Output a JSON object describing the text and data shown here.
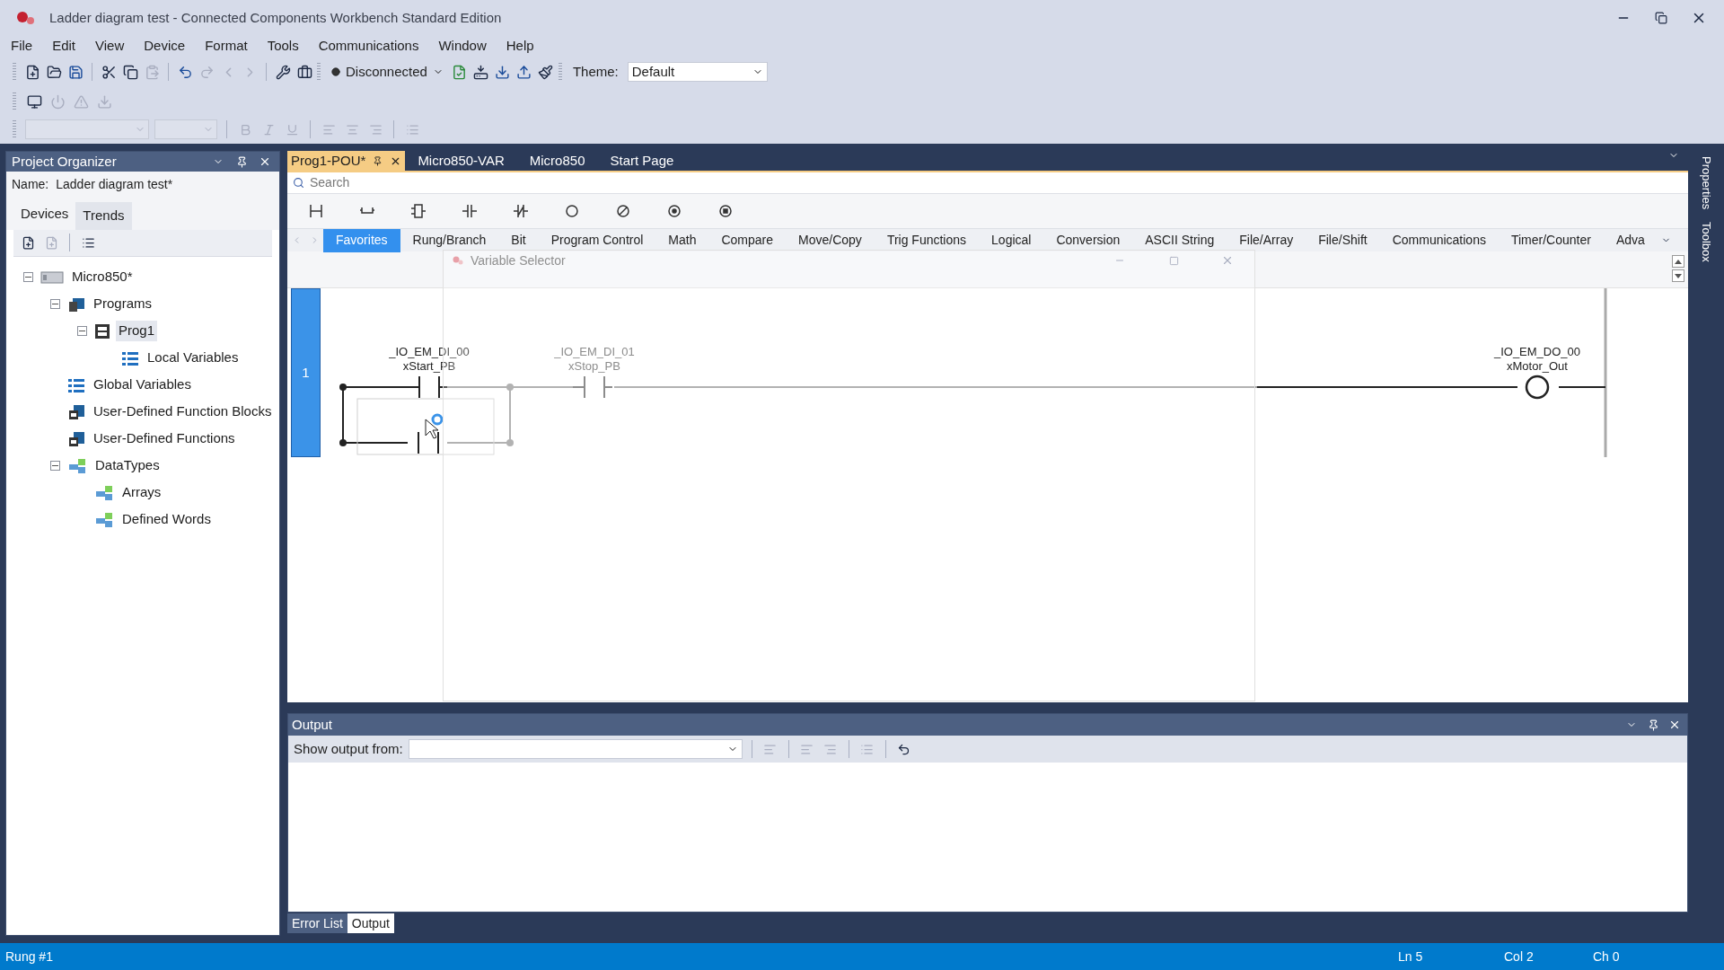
{
  "window": {
    "title": "Ladder diagram test - Connected Components Workbench Standard Edition"
  },
  "menu": [
    "File",
    "Edit",
    "View",
    "Device",
    "Format",
    "Tools",
    "Communications",
    "Window",
    "Help"
  ],
  "toolbar": {
    "connection": "Disconnected",
    "theme_label": "Theme:",
    "theme_value": "Default"
  },
  "project_organizer": {
    "title": "Project Organizer",
    "name_label": "Name:",
    "name_value": "Ladder diagram test*",
    "tabs": [
      {
        "label": "Devices",
        "selected": true
      },
      {
        "label": "Trends",
        "selected": false
      }
    ],
    "tree": [
      {
        "label": "Micro850*",
        "kind": "controller",
        "expanded": true,
        "selected": false,
        "children": [
          {
            "label": "Programs",
            "kind": "programs",
            "expanded": true,
            "selected": false,
            "children": [
              {
                "label": "Prog1",
                "kind": "program",
                "expanded": true,
                "selected": true,
                "children": [
                  {
                    "label": "Local Variables",
                    "kind": "variables",
                    "selected": false
                  }
                ]
              }
            ]
          },
          {
            "label": "Global Variables",
            "kind": "variables",
            "selected": false
          },
          {
            "label": "User-Defined Function Blocks",
            "kind": "function-blocks",
            "selected": false
          },
          {
            "label": "User-Defined Functions",
            "kind": "functions",
            "selected": false
          },
          {
            "label": "DataTypes",
            "kind": "datatypes",
            "expanded": true,
            "selected": false,
            "children": [
              {
                "label": "Arrays",
                "kind": "datatypes",
                "selected": false
              },
              {
                "label": "Defined Words",
                "kind": "datatypes",
                "selected": false
              }
            ]
          }
        ]
      }
    ]
  },
  "editor_tabs": [
    {
      "label": "Prog1-POU*",
      "selected": true
    },
    {
      "label": "Micro850-VAR",
      "selected": false
    },
    {
      "label": "Micro850",
      "selected": false
    },
    {
      "label": "Start Page",
      "selected": false
    }
  ],
  "toolbox": {
    "search_placeholder": "Search",
    "categories": [
      {
        "label": "Favorites",
        "selected": true
      },
      {
        "label": "Rung/Branch",
        "selected": false
      },
      {
        "label": "Bit",
        "selected": false
      },
      {
        "label": "Program Control",
        "selected": false
      },
      {
        "label": "Math",
        "selected": false
      },
      {
        "label": "Compare",
        "selected": false
      },
      {
        "label": "Move/Copy",
        "selected": false
      },
      {
        "label": "Trig Functions",
        "selected": false
      },
      {
        "label": "Logical",
        "selected": false
      },
      {
        "label": "Conversion",
        "selected": false
      },
      {
        "label": "ASCII String",
        "selected": false
      },
      {
        "label": "File/Array",
        "selected": false
      },
      {
        "label": "File/Shift",
        "selected": false
      },
      {
        "label": "Communications",
        "selected": false
      },
      {
        "label": "Timer/Counter",
        "selected": false
      },
      {
        "label": "Adva",
        "selected": false
      }
    ]
  },
  "variable_selector": {
    "title": "Variable Selector"
  },
  "rung": {
    "number": "1",
    "elements": [
      {
        "kind": "contact",
        "address": "_IO_EM_DI_00",
        "variable": "xStart_PB",
        "dimmed": false
      },
      {
        "kind": "contact",
        "address": "_IO_EM_DI_01",
        "variable": "xStop_PB",
        "dimmed": true
      },
      {
        "kind": "coil",
        "address": "_IO_EM_DO_00",
        "variable": "xMotor_Out",
        "dimmed": false
      }
    ]
  },
  "output": {
    "title": "Output",
    "show_label": "Show output from:"
  },
  "bottom_tabs": [
    {
      "label": "Error List",
      "selected": false
    },
    {
      "label": "Output",
      "selected": true
    }
  ],
  "side_tabs": [
    "Properties",
    "Toolbox"
  ],
  "status_bar": {
    "message": "Rung #1",
    "line": "Ln 5",
    "column": "Col 2",
    "char": "Ch 0"
  }
}
